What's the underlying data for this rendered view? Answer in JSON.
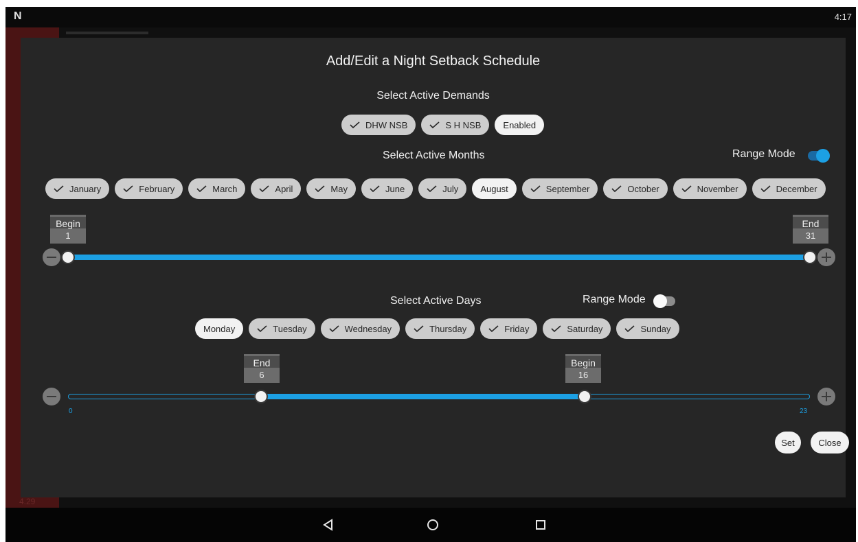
{
  "status": {
    "time": "4:17",
    "logo": "N"
  },
  "background": {
    "value_text": "4.29"
  },
  "dialog": {
    "title": "Add/Edit a Night Setback Schedule",
    "demands": {
      "heading": "Select Active Demands",
      "chips": [
        {
          "label": "DHW NSB",
          "checked": true
        },
        {
          "label": "S H NSB",
          "checked": true
        },
        {
          "label": "Enabled",
          "checked": false
        }
      ]
    },
    "months": {
      "heading": "Select Active Months",
      "range_mode_label": "Range Mode",
      "range_mode_on": true,
      "chips": [
        {
          "label": "January",
          "checked": true
        },
        {
          "label": "February",
          "checked": true
        },
        {
          "label": "March",
          "checked": true
        },
        {
          "label": "April",
          "checked": true
        },
        {
          "label": "May",
          "checked": true
        },
        {
          "label": "June",
          "checked": true
        },
        {
          "label": "July",
          "checked": true
        },
        {
          "label": "August",
          "checked": false
        },
        {
          "label": "September",
          "checked": true
        },
        {
          "label": "October",
          "checked": true
        },
        {
          "label": "November",
          "checked": true
        },
        {
          "label": "December",
          "checked": true
        }
      ],
      "slider": {
        "begin_label": "Begin",
        "begin_value": "1",
        "end_label": "End",
        "end_value": "31"
      }
    },
    "days": {
      "heading": "Select Active Days",
      "range_mode_label": "Range Mode",
      "range_mode_on": false,
      "chips": [
        {
          "label": "Monday",
          "checked": false
        },
        {
          "label": "Tuesday",
          "checked": true
        },
        {
          "label": "Wednesday",
          "checked": true
        },
        {
          "label": "Thursday",
          "checked": true
        },
        {
          "label": "Friday",
          "checked": true
        },
        {
          "label": "Saturday",
          "checked": true
        },
        {
          "label": "Sunday",
          "checked": true
        }
      ],
      "slider": {
        "end_label": "End",
        "end_value": "6",
        "begin_label": "Begin",
        "begin_value": "16",
        "min_label": "0",
        "max_label": "23",
        "min": 0,
        "max": 23
      }
    },
    "buttons": {
      "set": "Set",
      "close": "Close"
    }
  },
  "colors": {
    "accent": "#1ca0e4",
    "dialog_bg": "#262626",
    "chip_checked": "#cdcdcd",
    "chip_unchecked": "#f2f2f2"
  },
  "icons": {
    "check": "check-icon",
    "back": "back-triangle-icon",
    "home": "home-circle-icon",
    "recents": "recents-square-icon"
  }
}
